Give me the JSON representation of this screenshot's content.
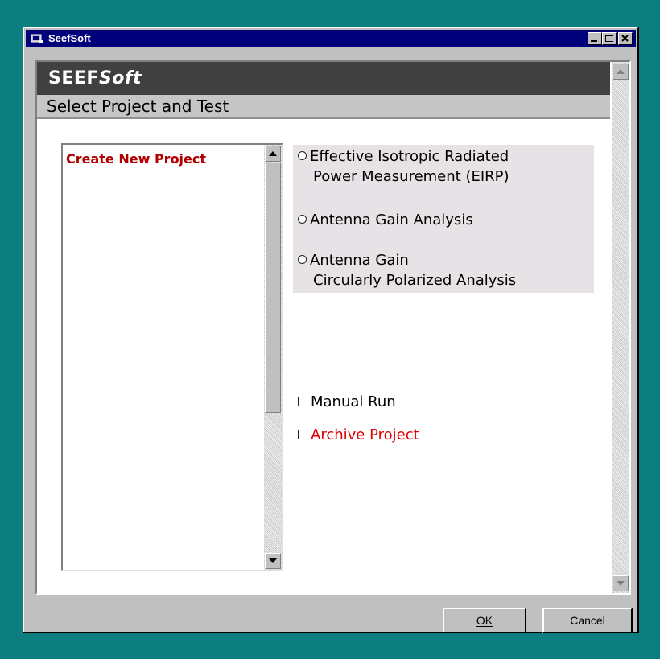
{
  "window": {
    "title": "SeefSoft"
  },
  "banner": {
    "brand_bold": "SEEF",
    "brand_italic": "Soft"
  },
  "subheader": {
    "title": "Select Project and Test"
  },
  "project_list": {
    "items": [
      "Create New Project"
    ]
  },
  "test_options": [
    {
      "line1": "Effective Isotropic Radiated",
      "line2": "Power Measurement (EIRP)"
    },
    {
      "line1": "Antenna Gain Analysis",
      "line2": ""
    },
    {
      "line1": "Antenna Gain",
      "line2": "Circularly Polarized Analysis"
    }
  ],
  "checkboxes": {
    "manual_run": "Manual Run",
    "archive_project": "Archive Project"
  },
  "buttons": {
    "ok": "OK",
    "cancel": "Cancel"
  },
  "colors": {
    "desktop": "#0c7e80",
    "titlebar": "#00007b",
    "banner": "#404040",
    "accent_red": "#e00000",
    "list_red": "#b00000"
  }
}
